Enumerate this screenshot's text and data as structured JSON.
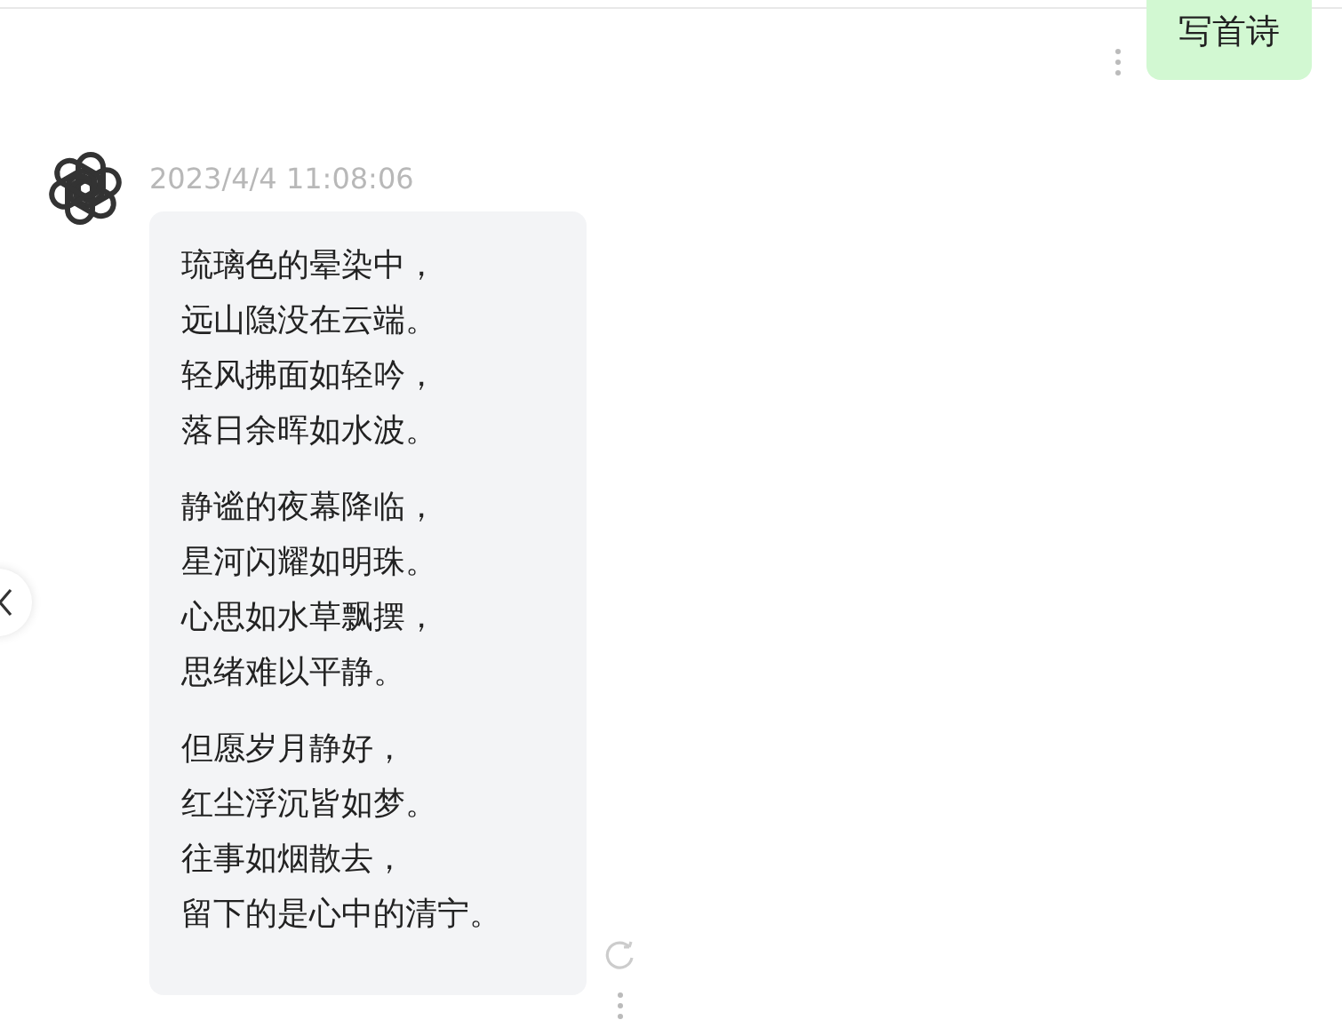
{
  "user_message": {
    "text": "写首诗"
  },
  "reply": {
    "timestamp": "2023/4/4 11:08:06",
    "stanzas": [
      [
        "琉璃色的晕染中，",
        "远山隐没在云端。",
        "轻风拂面如轻吟，",
        "落日余晖如水波。"
      ],
      [
        "静谧的夜幕降临，",
        "星河闪耀如明珠。",
        "心思如水草飘摆，",
        "思绪难以平静。"
      ],
      [
        "但愿岁月静好，",
        "红尘浮沉皆如梦。",
        "往事如烟散去，",
        "留下的是心中的清宁。"
      ]
    ]
  }
}
